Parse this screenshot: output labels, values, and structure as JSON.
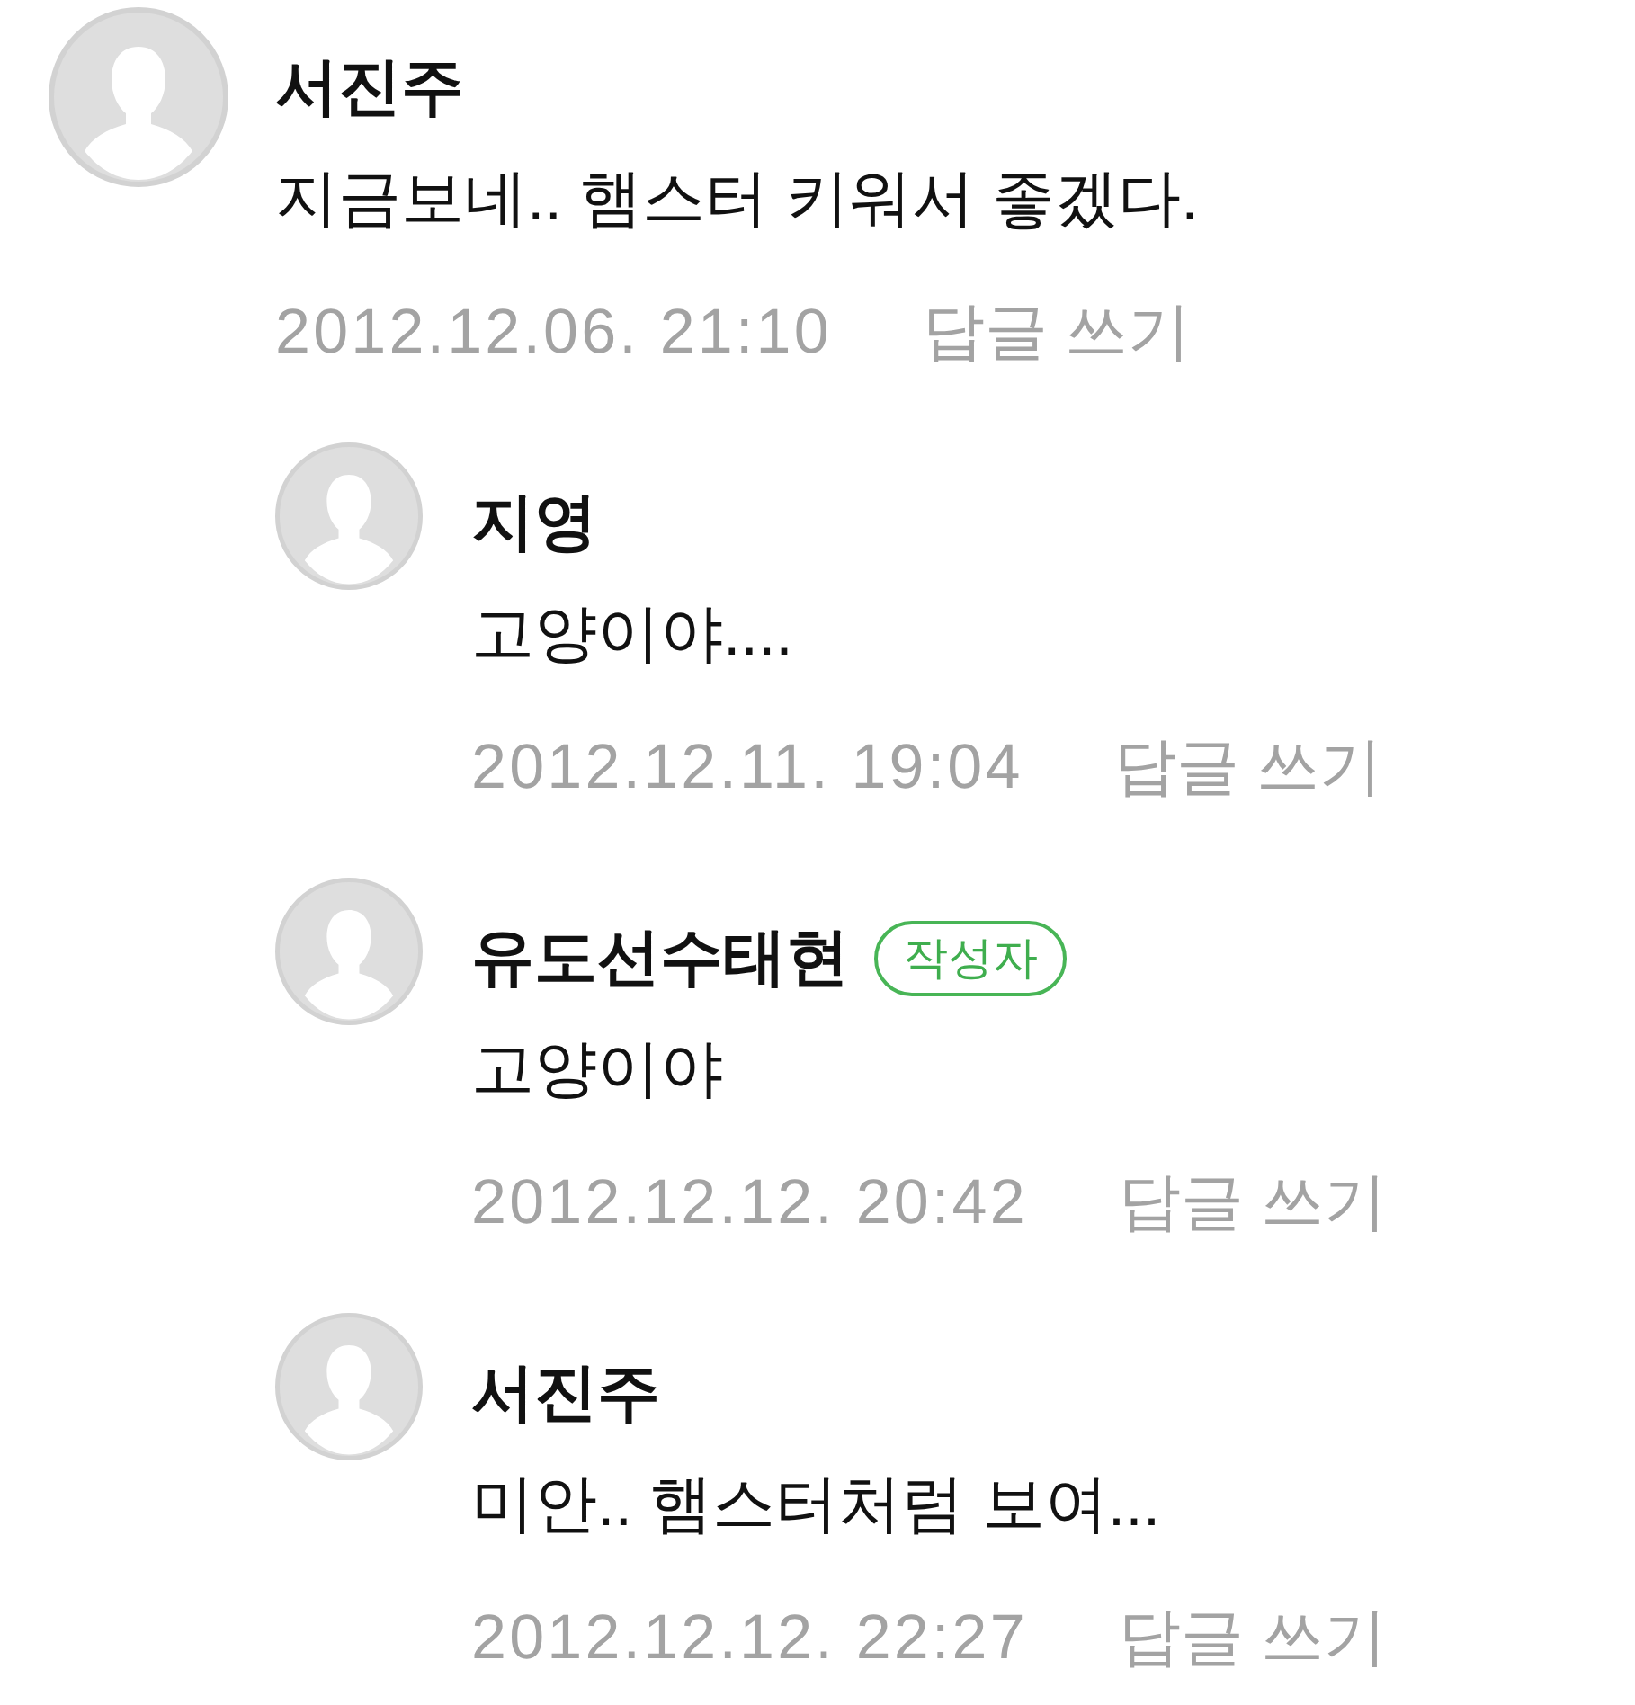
{
  "comments": [
    {
      "author": "서진주",
      "text": "지금보네.. 햄스터 키워서 좋겠다.",
      "date": "2012.12.06. 21:10",
      "reply_link": "답글 쓰기",
      "replies": [
        {
          "author": "지영",
          "text": "고양이야....",
          "date": "2012.12.11. 19:04",
          "reply_link": "답글 쓰기"
        },
        {
          "author": "유도선수태현",
          "badge": "작성자",
          "text": "고양이야",
          "date": "2012.12.12. 20:42",
          "reply_link": "답글 쓰기"
        },
        {
          "author": "서진주",
          "text": "미안.. 햄스터처럼 보여...",
          "date": "2012.12.12. 22:27",
          "reply_link": "답글 쓰기"
        }
      ]
    }
  ]
}
